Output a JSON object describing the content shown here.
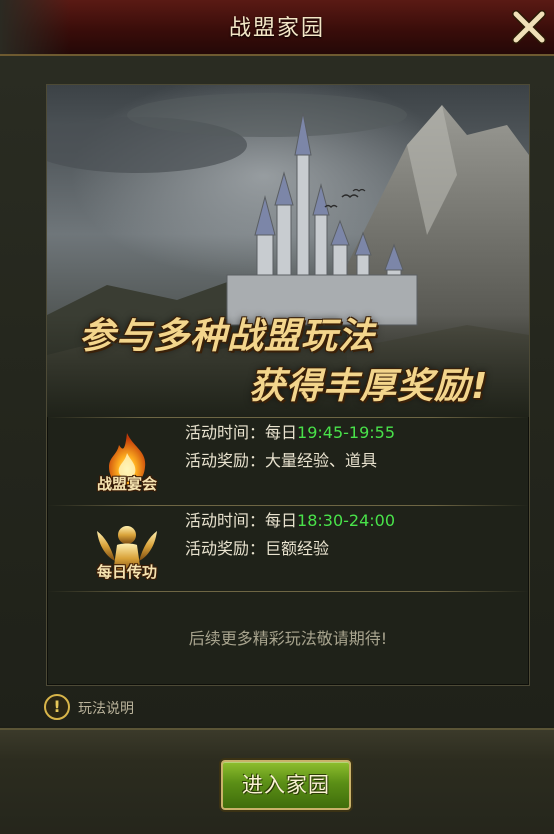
{
  "header": {
    "title": "战盟家园",
    "close_icon": "close-x-icon"
  },
  "banner": {
    "slogan_line1": "参与多种战盟玩法",
    "slogan_line2": "获得丰厚奖励!"
  },
  "activities": [
    {
      "name": "战盟宴会",
      "icon": "flame-icon",
      "time_label": "活动时间：每日",
      "time_value": "19:45-19:55",
      "reward_label": "活动奖励：",
      "reward_value": "大量经验、道具"
    },
    {
      "name": "每日传功",
      "icon": "winged-statue-icon",
      "time_label": "活动时间：每日",
      "time_value": "18:30-24:00",
      "reward_label": "活动奖励：",
      "reward_value": "巨额经验"
    }
  ],
  "footer_note": "后续更多精彩玩法敬请期待!",
  "help": {
    "label": "玩法说明",
    "icon": "exclamation-icon"
  },
  "enter_button": {
    "label": "进入家园"
  },
  "colors": {
    "time_green": "#49e24a",
    "title_bar": "#3a0d0a",
    "button_green": "#5b8f16"
  }
}
